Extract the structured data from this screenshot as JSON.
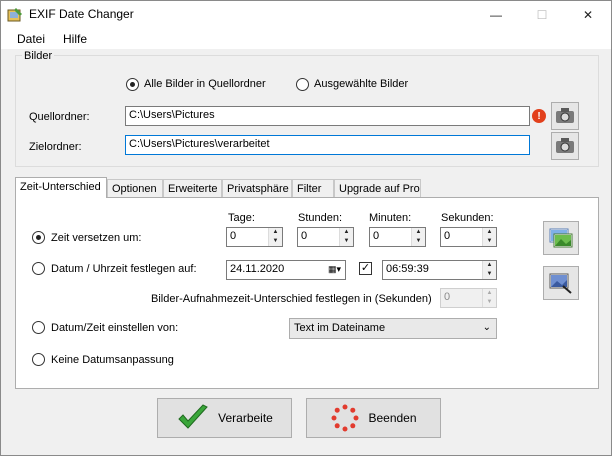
{
  "window": {
    "title": "EXIF Date Changer",
    "minimize_glyph": "—",
    "maximize_glyph": "☐",
    "close_glyph": "✕"
  },
  "menu": {
    "items": [
      "Datei",
      "Hilfe"
    ]
  },
  "images_group": {
    "legend": "Bilder",
    "radio_all": {
      "label": "Alle Bilder in Quellordner",
      "checked": true
    },
    "radio_selected": {
      "label": "Ausgewählte Bilder",
      "checked": false
    },
    "source_label": "Quellordner:",
    "source_value": "C:\\Users\\Pictures",
    "target_label": "Zielordner:",
    "target_value": "C:\\Users\\Pictures\\verarbeitet",
    "warn_glyph": "!"
  },
  "tabs": [
    {
      "label": "Zeit-Unterschied",
      "active": true
    },
    {
      "label": "Optionen",
      "active": false
    },
    {
      "label": "Erweiterte",
      "active": false
    },
    {
      "label": "Privatsphäre",
      "active": false
    },
    {
      "label": "Filter",
      "active": false
    },
    {
      "label": "Upgrade auf Pro",
      "active": false
    }
  ],
  "time_tab": {
    "col_headers": {
      "days": "Tage:",
      "hours": "Stunden:",
      "minutes": "Minuten:",
      "seconds": "Sekunden:"
    },
    "opt_shift": {
      "label": "Zeit versetzen um:",
      "checked": true
    },
    "shift_values": {
      "days": "0",
      "hours": "0",
      "minutes": "0",
      "seconds": "0"
    },
    "opt_set": {
      "label": "Datum / Uhrzeit festlegen auf:",
      "checked": false
    },
    "date_value": "24.11.2020",
    "time_enabled": true,
    "time_value": "06:59:39",
    "interval_label": "Bilder-Aufnahmezeit-Unterschied festlegen in (Sekunden)",
    "interval_value": "0",
    "opt_from": {
      "label": "Datum/Zeit einstellen von:",
      "checked": false
    },
    "source_select": "Text im Dateiname",
    "opt_none": {
      "label": "Keine Datumsanpassung",
      "checked": false
    }
  },
  "buttons": {
    "process": "Verarbeite",
    "exit": "Beenden"
  },
  "colors": {
    "accent": "#0078d7",
    "warning": "#e2401c",
    "check_green": "#3aa63a",
    "exit_red": "#e23b2e"
  }
}
